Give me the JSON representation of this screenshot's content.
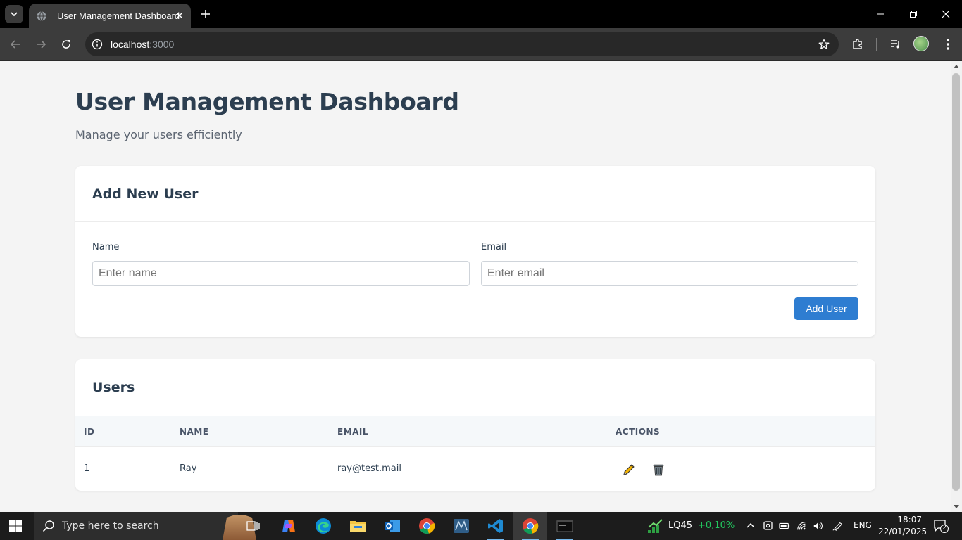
{
  "browser": {
    "tab_title": "User Management Dashboard",
    "url_host": "localhost",
    "url_port": ":3000"
  },
  "page": {
    "title": "User Management Dashboard",
    "subtitle": "Manage your users efficiently"
  },
  "add_user": {
    "heading": "Add New User",
    "name_label": "Name",
    "name_placeholder": "Enter name",
    "email_label": "Email",
    "email_placeholder": "Enter email",
    "submit_label": "Add User"
  },
  "users": {
    "heading": "Users",
    "columns": [
      "ID",
      "NAME",
      "EMAIL",
      "ACTIONS"
    ],
    "rows": [
      {
        "id": "1",
        "name": "Ray",
        "email": "ray@test.mail"
      }
    ]
  },
  "taskbar": {
    "search_placeholder": "Type here to search",
    "stock_name": "LQ45",
    "stock_change": "+0,10%",
    "language": "ENG",
    "time": "18:07",
    "date": "22/01/2025",
    "notification_count": "2"
  },
  "colors": {
    "primary_button": "#2e7dd1",
    "heading_text": "#2c3e50",
    "page_background": "#f4f4f4",
    "stock_positive": "#22c55e"
  }
}
